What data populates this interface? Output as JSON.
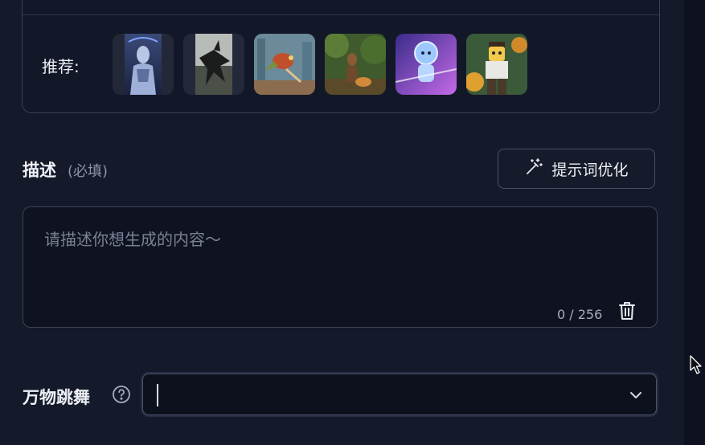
{
  "recommend": {
    "label": "推荐:",
    "thumbnails": [
      {
        "name": "cyborg-woman"
      },
      {
        "name": "dark-dragon"
      },
      {
        "name": "city-parrot"
      },
      {
        "name": "forest-adventurer"
      },
      {
        "name": "space-astronaut-kid"
      },
      {
        "name": "lego-figure"
      }
    ]
  },
  "description": {
    "title": "描述",
    "hint": "(必填)",
    "optimize_button": "提示词优化",
    "optimize_icon": "magic-wand-icon",
    "placeholder": "请描述你想生成的内容～",
    "value": "",
    "char_count": "0 / 256",
    "clear_icon": "trash-icon"
  },
  "dance": {
    "label": "万物跳舞",
    "help_icon": "question-circle-icon",
    "selected": "",
    "dropdown_icon": "chevron-down-icon"
  },
  "colors": {
    "background": "#151a2a",
    "panel": "#131828",
    "border": "#3b4154",
    "text": "#eef0f6",
    "muted": "#8d93a6"
  }
}
